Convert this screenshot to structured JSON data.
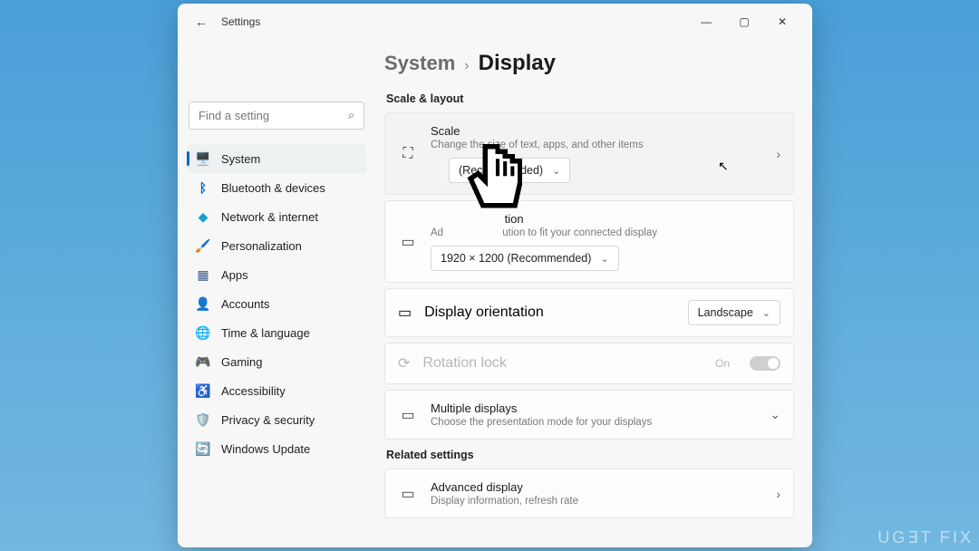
{
  "window": {
    "title": "Settings",
    "min": "—",
    "max": "▢",
    "close": "✕"
  },
  "search": {
    "placeholder": "Find a setting"
  },
  "nav": {
    "items": [
      {
        "icon": "🖥️",
        "label": "System",
        "color": "#0067c0"
      },
      {
        "icon": "ᛒ",
        "label": "Bluetooth & devices",
        "color": "#0067c0"
      },
      {
        "icon": "◆",
        "label": "Network & internet",
        "color": "#16a0d5"
      },
      {
        "icon": "🖌️",
        "label": "Personalization",
        "color": "#e06a1a"
      },
      {
        "icon": "▦",
        "label": "Apps",
        "color": "#3a5a8c"
      },
      {
        "icon": "👤",
        "label": "Accounts",
        "color": "#2e8b57"
      },
      {
        "icon": "🌐",
        "label": "Time & language",
        "color": "#1e88c9"
      },
      {
        "icon": "🎮",
        "label": "Gaming",
        "color": "#888"
      },
      {
        "icon": "♿",
        "label": "Accessibility",
        "color": "#0a4fa0"
      },
      {
        "icon": "🛡️",
        "label": "Privacy & security",
        "color": "#444"
      },
      {
        "icon": "🔄",
        "label": "Windows Update",
        "color": "#0a7fc0"
      }
    ]
  },
  "breadcrumb": {
    "parent": "System",
    "sep": "›",
    "current": "Display"
  },
  "sections": {
    "scale_layout": "Scale & layout",
    "related": "Related settings"
  },
  "scale": {
    "title": "Scale",
    "desc": "Change the size of text, apps, and other items",
    "value": "(Recommended)"
  },
  "resolution": {
    "title_fragment": "tion",
    "desc_prefix": "Ad",
    "desc_suffix": "ution to fit your connected display",
    "value": "1920 × 1200 (Recommended)"
  },
  "orientation": {
    "title": "Display orientation",
    "value": "Landscape"
  },
  "rotation": {
    "title": "Rotation lock",
    "state": "On"
  },
  "multiple": {
    "title": "Multiple displays",
    "desc": "Choose the presentation mode for your displays"
  },
  "advanced": {
    "title": "Advanced display",
    "desc": "Display information, refresh rate"
  },
  "watermark": "UG∃T ᖴIX"
}
